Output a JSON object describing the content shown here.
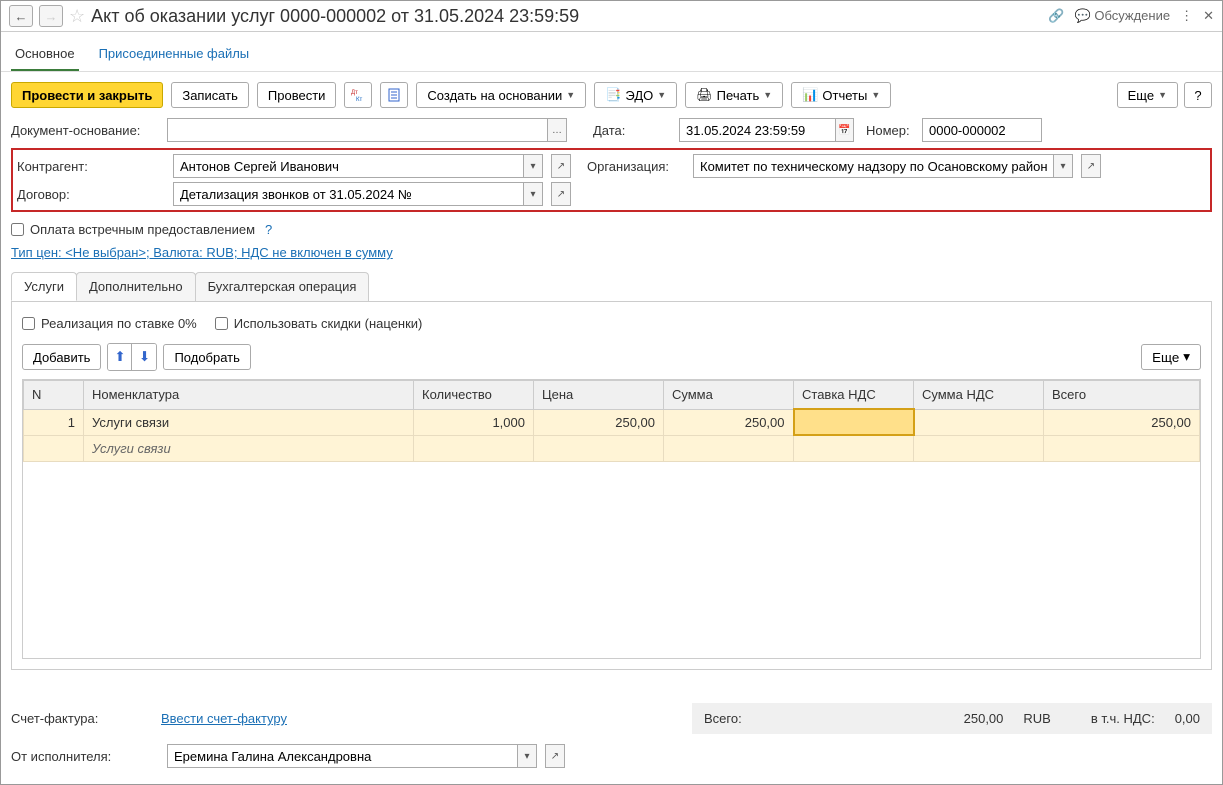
{
  "header": {
    "title": "Акт об оказании услуг 0000-000002 от 31.05.2024 23:59:59",
    "discussion": "Обсуждение"
  },
  "navTabs": {
    "main": "Основное",
    "attached": "Присоединенные файлы"
  },
  "toolbar": {
    "post_close": "Провести и закрыть",
    "save": "Записать",
    "post": "Провести",
    "create_based": "Создать на основании",
    "edo": "ЭДО",
    "print": "Печать",
    "reports": "Отчеты",
    "more": "Еще",
    "help": "?"
  },
  "fields": {
    "doc_basis_label": "Документ-основание:",
    "doc_basis_value": "",
    "date_label": "Дата:",
    "date_value": "31.05.2024 23:59:59",
    "number_label": "Номер:",
    "number_value": "0000-000002",
    "counterparty_label": "Контрагент:",
    "counterparty_value": "Антонов Сергей Иванович",
    "org_label": "Организация:",
    "org_value": "Комитет по техническому надзору по Осановскому району",
    "contract_label": "Договор:",
    "contract_value": "Детализация звонков от 31.05.2024 №",
    "counter_payment": "Оплата встречным предоставлением",
    "price_type_link": "Тип цен: <Не выбран>; Валюта: RUB; НДС не включен в сумму"
  },
  "subTabs": {
    "services": "Услуги",
    "additional": "Дополнительно",
    "accounting": "Бухгалтерская операция"
  },
  "serviceTab": {
    "zero_rate": "Реализация по ставке 0%",
    "use_discounts": "Использовать скидки (наценки)",
    "add": "Добавить",
    "pick": "Подобрать",
    "more": "Еще"
  },
  "table": {
    "headers": {
      "n": "N",
      "nomenclature": "Номенклатура",
      "qty": "Количество",
      "price": "Цена",
      "sum": "Сумма",
      "vat_rate": "Ставка НДС",
      "vat_sum": "Сумма НДС",
      "total": "Всего"
    },
    "rows": [
      {
        "n": "1",
        "nomenclature": "Услуги связи",
        "nomenclature_sub": "Услуги связи",
        "qty": "1,000",
        "price": "250,00",
        "sum": "250,00",
        "vat_rate": "",
        "vat_sum": "",
        "total": "250,00"
      }
    ]
  },
  "footer": {
    "invoice_label": "Счет-фактура:",
    "invoice_link": "Ввести счет-фактуру",
    "total_label": "Всего:",
    "total_value": "250,00",
    "currency": "RUB",
    "vat_label": "в т.ч. НДС:",
    "vat_value": "0,00",
    "performer_label": "От исполнителя:",
    "performer_value": "Еремина Галина Александровна"
  }
}
